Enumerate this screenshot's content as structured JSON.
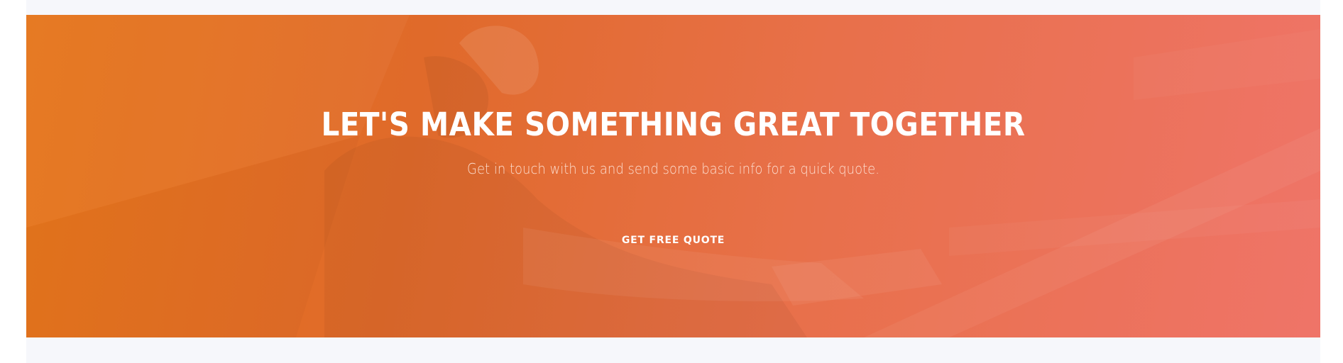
{
  "hero": {
    "title": "LET'S MAKE SOMETHING GREAT TOGETHER",
    "subtitle": "Get in touch with us and send some basic info for a quick quote.",
    "cta_label": "GET FREE QUOTE",
    "background_image": "construction-worker-photo",
    "colors": {
      "gradient_start": "#e6761b",
      "gradient_end": "#ef7468",
      "text": "#ffffff",
      "page_background": "#f6f7fb"
    }
  }
}
